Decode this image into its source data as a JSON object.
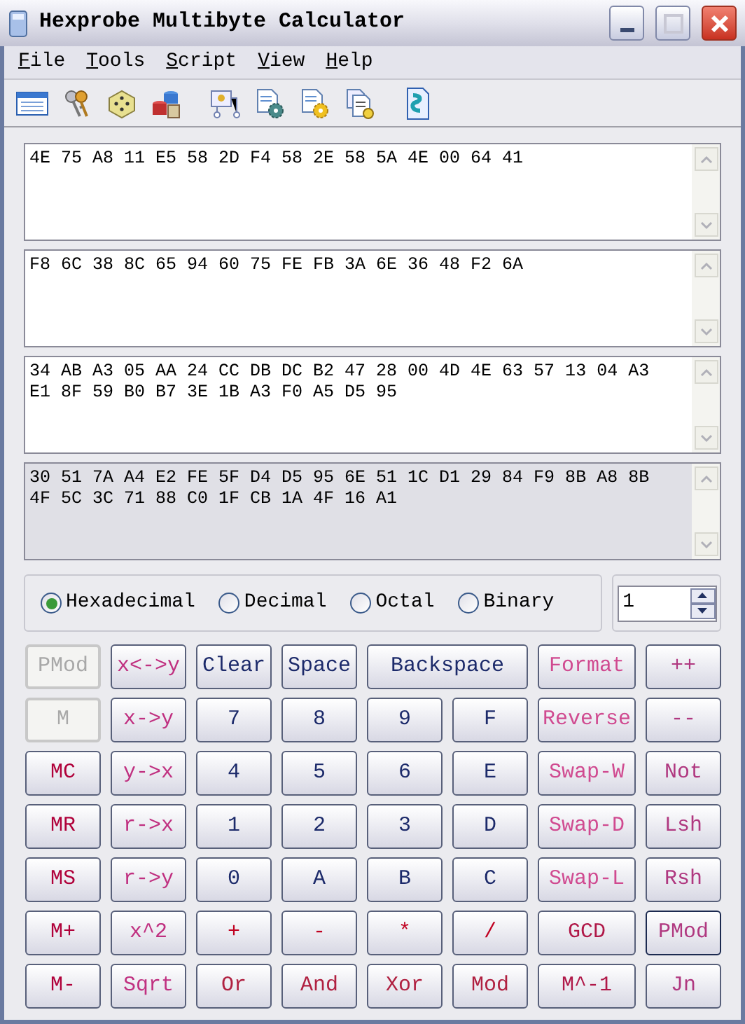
{
  "window": {
    "title": "Hexprobe Multibyte Calculator"
  },
  "menu": [
    "File",
    "Tools",
    "Script",
    "View",
    "Help"
  ],
  "registers": [
    {
      "lines": [
        "4E 75 A8 11 E5 58 2D F4 58 2E 58 5A 4E 00 64 41"
      ],
      "readonly": false
    },
    {
      "lines": [
        "F8 6C 38 8C 65 94 60 75 FE FB 3A 6E 36 48 F2 6A"
      ],
      "readonly": false
    },
    {
      "lines": [
        "34 AB A3 05 AA 24 CC DB DC B2 47 28 00 4D 4E 63 57 13 04 A3",
        "E1 8F 59 B0 B7 3E 1B A3 F0 A5 D5 95"
      ],
      "readonly": false
    },
    {
      "lines": [
        "30 51 7A A4 E2 FE 5F D4 D5 95 6E 51 1C D1 29 84 F9 8B A8 8B",
        "4F 5C 3C 71 88 C0 1F CB 1A 4F 16 A1"
      ],
      "readonly": true
    }
  ],
  "radix": [
    {
      "label": "Hexadecimal",
      "selected": true
    },
    {
      "label": "Decimal",
      "selected": false
    },
    {
      "label": "Octal",
      "selected": false
    },
    {
      "label": "Binary",
      "selected": false
    }
  ],
  "spin": {
    "value": "1"
  },
  "buttons": [
    [
      {
        "label": "PMod",
        "kind": "mem",
        "disabled": true,
        "focused": false
      },
      {
        "label": "x<->y",
        "kind": "reg",
        "disabled": false,
        "focused": false
      },
      {
        "label": "Clear",
        "kind": "num",
        "disabled": false,
        "focused": false
      },
      {
        "label": "Space",
        "kind": "num",
        "disabled": false,
        "focused": false
      },
      {
        "label": "Backspace",
        "kind": "num",
        "disabled": false,
        "focused": false
      },
      {
        "label": "Format",
        "kind": "fmt",
        "disabled": false,
        "focused": false
      },
      {
        "label": "++",
        "kind": "unary",
        "disabled": false,
        "focused": false
      }
    ],
    [
      {
        "label": "M",
        "kind": "mem",
        "disabled": true,
        "focused": false
      },
      {
        "label": "x->y",
        "kind": "reg",
        "disabled": false,
        "focused": false
      },
      {
        "label": "7",
        "kind": "num",
        "disabled": false,
        "focused": false
      },
      {
        "label": "8",
        "kind": "num",
        "disabled": false,
        "focused": false
      },
      {
        "label": "9",
        "kind": "num",
        "disabled": false,
        "focused": false
      },
      {
        "label": "F",
        "kind": "num",
        "disabled": false,
        "focused": false
      },
      {
        "label": "Reverse",
        "kind": "fmt",
        "disabled": false,
        "focused": false
      },
      {
        "label": "--",
        "kind": "unary",
        "disabled": false,
        "focused": false
      }
    ],
    [
      {
        "label": "MC",
        "kind": "mem",
        "disabled": false,
        "focused": false
      },
      {
        "label": "y->x",
        "kind": "reg",
        "disabled": false,
        "focused": false
      },
      {
        "label": "4",
        "kind": "num",
        "disabled": false,
        "focused": false
      },
      {
        "label": "5",
        "kind": "num",
        "disabled": false,
        "focused": false
      },
      {
        "label": "6",
        "kind": "num",
        "disabled": false,
        "focused": false
      },
      {
        "label": "E",
        "kind": "num",
        "disabled": false,
        "focused": false
      },
      {
        "label": "Swap-W",
        "kind": "fmt",
        "disabled": false,
        "focused": false
      },
      {
        "label": "Not",
        "kind": "unary",
        "disabled": false,
        "focused": false
      }
    ],
    [
      {
        "label": "MR",
        "kind": "mem",
        "disabled": false,
        "focused": false
      },
      {
        "label": "r->x",
        "kind": "reg",
        "disabled": false,
        "focused": false
      },
      {
        "label": "1",
        "kind": "num",
        "disabled": false,
        "focused": false
      },
      {
        "label": "2",
        "kind": "num",
        "disabled": false,
        "focused": false
      },
      {
        "label": "3",
        "kind": "num",
        "disabled": false,
        "focused": false
      },
      {
        "label": "D",
        "kind": "num",
        "disabled": false,
        "focused": false
      },
      {
        "label": "Swap-D",
        "kind": "fmt",
        "disabled": false,
        "focused": false
      },
      {
        "label": "Lsh",
        "kind": "unary",
        "disabled": false,
        "focused": false
      }
    ],
    [
      {
        "label": "MS",
        "kind": "mem",
        "disabled": false,
        "focused": false
      },
      {
        "label": "r->y",
        "kind": "reg",
        "disabled": false,
        "focused": false
      },
      {
        "label": "0",
        "kind": "num",
        "disabled": false,
        "focused": false
      },
      {
        "label": "A",
        "kind": "num",
        "disabled": false,
        "focused": false
      },
      {
        "label": "B",
        "kind": "num",
        "disabled": false,
        "focused": false
      },
      {
        "label": "C",
        "kind": "num",
        "disabled": false,
        "focused": false
      },
      {
        "label": "Swap-L",
        "kind": "fmt",
        "disabled": false,
        "focused": false
      },
      {
        "label": "Rsh",
        "kind": "unary",
        "disabled": false,
        "focused": false
      }
    ],
    [
      {
        "label": "M+",
        "kind": "mem",
        "disabled": false,
        "focused": false
      },
      {
        "label": "x^2",
        "kind": "reg",
        "disabled": false,
        "focused": false
      },
      {
        "label": "+",
        "kind": "arith",
        "disabled": false,
        "focused": false
      },
      {
        "label": "-",
        "kind": "arith",
        "disabled": false,
        "focused": false
      },
      {
        "label": "*",
        "kind": "arith",
        "disabled": false,
        "focused": false
      },
      {
        "label": "/",
        "kind": "arith",
        "disabled": false,
        "focused": false
      },
      {
        "label": "GCD",
        "kind": "modular",
        "disabled": false,
        "focused": false
      },
      {
        "label": "PMod",
        "kind": "unary",
        "disabled": false,
        "focused": true
      }
    ],
    [
      {
        "label": "M-",
        "kind": "mem",
        "disabled": false,
        "focused": false
      },
      {
        "label": "Sqrt",
        "kind": "reg",
        "disabled": false,
        "focused": false
      },
      {
        "label": "Or",
        "kind": "logic",
        "disabled": false,
        "focused": false
      },
      {
        "label": "And",
        "kind": "logic",
        "disabled": false,
        "focused": false
      },
      {
        "label": "Xor",
        "kind": "logic",
        "disabled": false,
        "focused": false
      },
      {
        "label": "Mod",
        "kind": "logic",
        "disabled": false,
        "focused": false
      },
      {
        "label": "M^-1",
        "kind": "modular",
        "disabled": false,
        "focused": false
      },
      {
        "label": "Jn",
        "kind": "unary",
        "disabled": false,
        "focused": false
      }
    ]
  ]
}
